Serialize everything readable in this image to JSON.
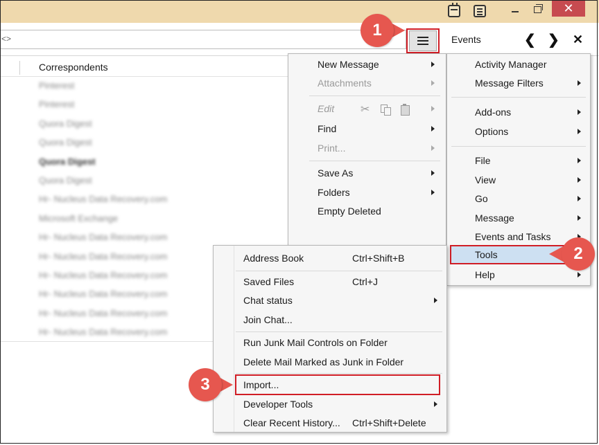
{
  "toolbar": {
    "search_glyph": "<>",
    "events_label": "Events",
    "prev_glyph": "❮",
    "next_glyph": "❯",
    "close_glyph": "✕"
  },
  "window_controls": {
    "close_glyph": "✕"
  },
  "message_list": {
    "column_header": "Correspondents",
    "rows": [
      "Pinterest",
      "Pinterest",
      "Quora Digest",
      "Quora Digest",
      "Quora Digest",
      "Quora Digest",
      "Hr- Nucleus Data Recovery.com",
      "Microsoft Exchange",
      "Hr- Nucleus Data Recovery.com",
      "Hr- Nucleus Data Recovery.com",
      "Hr- Nucleus Data Recovery.com",
      "Hr- Nucleus Data Recovery.com",
      "Hr- Nucleus Data Recovery.com",
      "Hr- Nucleus Data Recovery.com"
    ]
  },
  "main_menu": {
    "new_message": "New Message",
    "attachments": "Attachments",
    "edit": "Edit",
    "find": "Find",
    "print": "Print...",
    "save_as": "Save As",
    "folders": "Folders",
    "empty_deleted": "Empty Deleted"
  },
  "side_menu": {
    "activity_manager": "Activity Manager",
    "message_filters": "Message Filters",
    "add_ons": "Add-ons",
    "options": "Options",
    "file": "File",
    "view": "View",
    "go": "Go",
    "message": "Message",
    "events_and_tasks": "Events and Tasks",
    "tools": "Tools",
    "help": "Help"
  },
  "tools_menu": {
    "address_book": "Address Book",
    "address_book_shortcut": "Ctrl+Shift+B",
    "saved_files": "Saved Files",
    "saved_files_shortcut": "Ctrl+J",
    "chat_status": "Chat status",
    "join_chat": "Join Chat...",
    "run_junk": "Run Junk Mail Controls on Folder",
    "delete_junk": "Delete Mail Marked as Junk in Folder",
    "import": "Import...",
    "developer_tools": "Developer Tools",
    "clear_history": "Clear Recent History...",
    "clear_history_shortcut": "Ctrl+Shift+Delete"
  },
  "callouts": {
    "step1": "1",
    "step2": "2",
    "step3": "3"
  },
  "colors": {
    "titlebar": "#efd9ad",
    "close_button": "#c74b50",
    "highlight_outline": "#d01d25",
    "callout": "#e6574f",
    "selected_item": "#cde0f2"
  }
}
